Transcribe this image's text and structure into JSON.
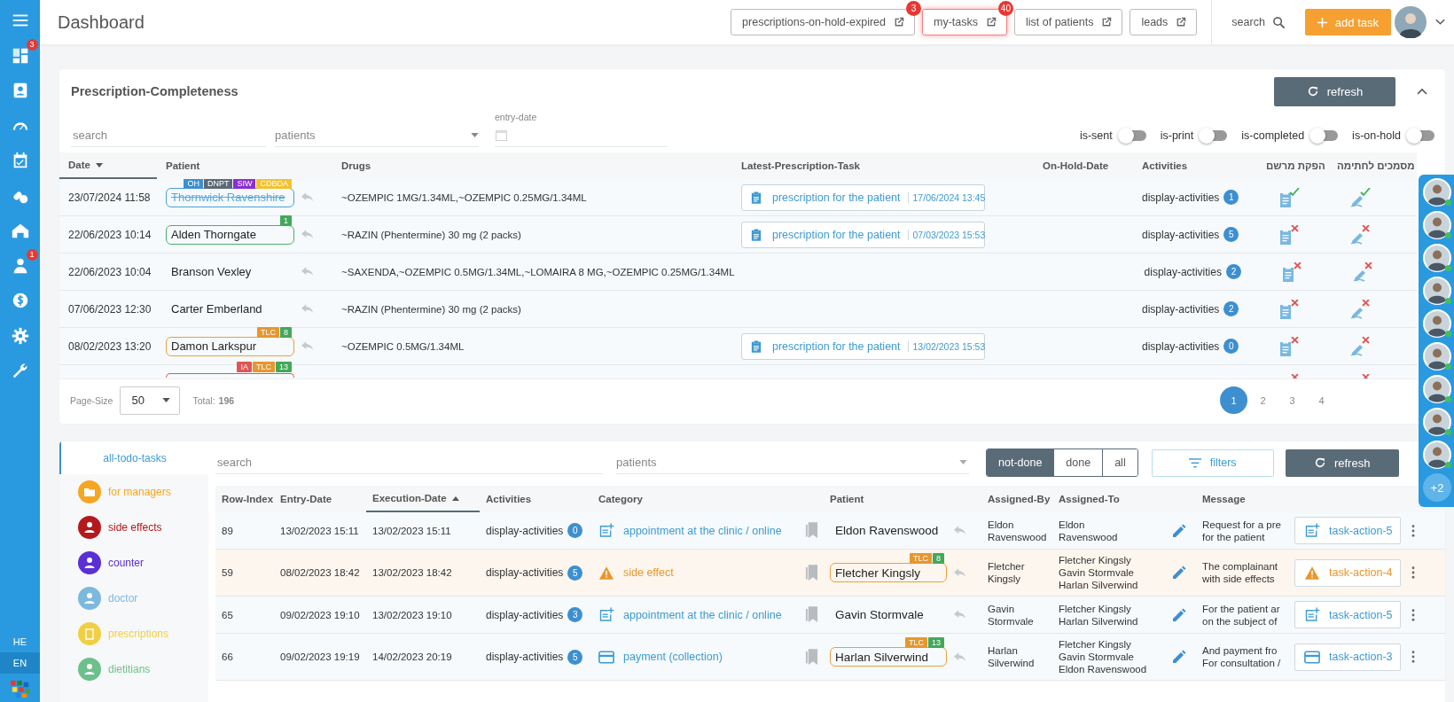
{
  "sidebar": {
    "items": [
      {
        "kind": "menu"
      },
      {
        "kind": "dashboard",
        "badge": "3"
      },
      {
        "kind": "contact"
      },
      {
        "kind": "gauge"
      },
      {
        "kind": "calendar"
      },
      {
        "kind": "pills"
      },
      {
        "kind": "home"
      },
      {
        "kind": "doctor",
        "badge": "1"
      },
      {
        "kind": "dollar"
      },
      {
        "kind": "gear"
      },
      {
        "kind": "wrench"
      }
    ],
    "languages": [
      {
        "label": "HE",
        "selected": false
      },
      {
        "label": "EN",
        "selected": true
      }
    ]
  },
  "header": {
    "title": "Dashboard",
    "links": [
      {
        "label": "prescriptions-on-hold-expired",
        "badge": "3",
        "highlighted": false
      },
      {
        "label": "my-tasks",
        "badge": "40",
        "highlighted": true
      },
      {
        "label": "list of patients",
        "highlighted": false
      },
      {
        "label": "leads",
        "highlighted": false
      }
    ],
    "search": "search",
    "add_button": "add task"
  },
  "prescriptions": {
    "title": "Prescription-Completeness",
    "refresh": "refresh",
    "expanded": true,
    "search_placeholder": "search",
    "patients_placeholder": "patients",
    "date_label": "entry-date",
    "toggles": [
      {
        "label": "is-sent",
        "on": false
      },
      {
        "label": "is-print",
        "on": false
      },
      {
        "label": "is-completed",
        "on": false
      },
      {
        "label": "is-on-hold",
        "on": false
      }
    ],
    "columns": [
      {
        "label": "Date",
        "sorted": true,
        "descending": true
      },
      {
        "label": "Patient",
        "sorted": false
      },
      {
        "label": "Drugs",
        "sorted": false
      },
      {
        "label": "Latest-Prescription-Task",
        "sorted": false
      },
      {
        "label": "On-Hold-Date",
        "sorted": false
      },
      {
        "label": "Activities",
        "sorted": false
      },
      {
        "label": "הפקת מרשם",
        "sorted": false
      },
      {
        "label": "מסמכים לחתימה",
        "sorted": false
      }
    ],
    "rows": [
      {
        "date": "23/07/2024 11:58",
        "patient": {
          "name": "Thornwick Ravenshire",
          "struck": true,
          "color": "#4a9fd6",
          "tags": [
            {
              "label": "OH",
              "color": "#3d8fd0"
            },
            {
              "label": "DNPT",
              "color": "#5d6a75"
            },
            {
              "label": "SIW",
              "color": "#8a2fd0"
            },
            {
              "label": "CDBDA",
              "color": "#f2c230"
            }
          ]
        },
        "drugs": "~OZEMPIC 1MG/1.34ML,~OZEMPIC 0.25MG/1.34ML",
        "task": {
          "label": "prescription for the patient",
          "date": "17/06/2024 13:45"
        },
        "activities": {
          "label": "display-activities",
          "count": "1"
        },
        "dispensed": true,
        "signed": true
      },
      {
        "date": "22/06/2023 10:14",
        "patient": {
          "name": "Alden Thorngate",
          "struck": false,
          "color": "#4caf6a",
          "tags": [
            {
              "label": "1",
              "color": "#43a85a"
            }
          ]
        },
        "drugs": "~RAZIN (Phentermine) 30 mg (2 packs)",
        "task": {
          "label": "prescription for the patient",
          "date": "07/03/2023 15:53"
        },
        "activities": {
          "label": "display-activities",
          "count": "5"
        },
        "dispensed": false,
        "signed": false
      },
      {
        "date": "22/06/2023 10:04",
        "patient": {
          "name": "Branson Vexley",
          "struck": false
        },
        "drugs": "~SAXENDA,~OZEMPIC 0.5MG/1.34ML,~LOMAIRA 8 MG,~OZEMPIC 0.25MG/1.34ML",
        "activities": {
          "label": "display-activities",
          "count": "2"
        },
        "dispensed": false,
        "signed": false
      },
      {
        "date": "07/06/2023 12:30",
        "patient": {
          "name": "Carter Emberland",
          "struck": false
        },
        "drugs": "~RAZIN (Phentermine) 30 mg (2 packs)",
        "activities": {
          "label": "display-activities",
          "count": "2"
        },
        "dispensed": false,
        "signed": false
      },
      {
        "date": "08/02/2023 13:20",
        "patient": {
          "name": "Damon Larkspur",
          "struck": false,
          "color": "#e8a040",
          "tags": [
            {
              "label": "TLC",
              "color": "#e8962e"
            },
            {
              "label": "8",
              "color": "#43a85a"
            }
          ]
        },
        "drugs": "~OZEMPIC 0.5MG/1.34ML",
        "task": {
          "label": "prescription for the patient",
          "date": "13/02/2023 15:53"
        },
        "activities": {
          "label": "display-activities",
          "count": "0"
        },
        "dispensed": false,
        "signed": false
      },
      {
        "patient": {
          "color": "#e05555",
          "tags": [
            {
              "label": "IA",
              "color": "#e05555"
            },
            {
              "label": "TLC",
              "color": "#e8962e"
            },
            {
              "label": "13",
              "color": "#43a85a"
            }
          ]
        },
        "dispensed": false,
        "signed": false
      }
    ],
    "page_size_label": "Page-Size",
    "page_size": "50",
    "total_label": "Total:",
    "total": "196",
    "pages": [
      {
        "label": "1",
        "selected": true
      },
      {
        "label": "2",
        "selected": false
      },
      {
        "label": "3",
        "selected": false
      },
      {
        "label": "4",
        "selected": false
      }
    ]
  },
  "tasks": {
    "tabs": [
      {
        "label": "all-todo-tasks",
        "selected": true
      }
    ],
    "categories": [
      {
        "kind": "managers",
        "label": "for managers",
        "color": "#f5a623"
      },
      {
        "kind": "side-effects",
        "label": "side effects",
        "color": "#b3191c"
      },
      {
        "kind": "counter",
        "label": "counter",
        "color": "#5a2fd6"
      },
      {
        "kind": "doctor",
        "label": "doctor",
        "color": "#7db8de"
      },
      {
        "kind": "prescriptions",
        "label": "prescriptions",
        "color": "#f0cf45"
      },
      {
        "kind": "dietitians",
        "label": "dietitians",
        "color": "#6cc08b"
      }
    ],
    "search_placeholder": "search",
    "patients_placeholder": "patients",
    "status": [
      {
        "label": "not-done",
        "selected": true
      },
      {
        "label": "done",
        "selected": false
      },
      {
        "label": "all",
        "selected": false
      }
    ],
    "filters": "filters",
    "refresh": "refresh",
    "columns": [
      {
        "label": "Row-Index",
        "sorted": false
      },
      {
        "label": "Entry-Date",
        "sorted": false
      },
      {
        "label": "Execution-Date",
        "sorted": true,
        "descending": false
      },
      {
        "label": "Activities",
        "sorted": false
      },
      {
        "label": "Category",
        "sorted": false
      },
      {
        "label": "Patient",
        "sorted": false
      },
      {
        "label": "Assigned-By",
        "sorted": false
      },
      {
        "label": "Assigned-To",
        "sorted": false
      },
      {
        "label": "Message",
        "sorted": false
      }
    ],
    "rows": [
      {
        "index": "89",
        "entry": "13/02/2023 15:11",
        "execution": "13/02/2023 15:11",
        "activities": {
          "label": "display-activities",
          "count": "0"
        },
        "highlighted": false,
        "category": {
          "kind": "appointment",
          "label": "appointment at the clinic / online",
          "color": "#3d9bd2"
        },
        "patient": {
          "name": "Eldon Ravenswood"
        },
        "assigned_by": [
          "Eldon",
          "Ravenswood"
        ],
        "assigned_to": [
          "Eldon",
          "Ravenswood"
        ],
        "message": [
          "Request for a pre",
          "for the patient"
        ],
        "action": {
          "kind": "appointment",
          "label": "task-action-5",
          "color": "#3d9bd2"
        }
      },
      {
        "index": "59",
        "entry": "08/02/2023 18:42",
        "execution": "13/02/2023 18:42",
        "activities": {
          "label": "display-activities",
          "count": "5"
        },
        "highlighted": true,
        "category": {
          "kind": "warning",
          "label": "side effect",
          "color": "#e8962e"
        },
        "patient": {
          "name": "Fletcher Kingsly",
          "color": "#e8a040",
          "tags": [
            {
              "label": "TLC",
              "color": "#e8962e"
            },
            {
              "label": "8",
              "color": "#43a85a"
            }
          ]
        },
        "assigned_by": [
          "Fletcher",
          "Kingsly"
        ],
        "assigned_to": [
          "Fletcher Kingsly",
          "Gavin Stormvale",
          "Harlan Silverwind"
        ],
        "message": [
          "The complainant",
          "with side effects"
        ],
        "action": {
          "kind": "warning",
          "label": "task-action-4",
          "color": "#e8962e"
        }
      },
      {
        "index": "65",
        "entry": "09/02/2023 19:10",
        "execution": "13/02/2023 19:10",
        "activities": {
          "label": "display-activities",
          "count": "3"
        },
        "highlighted": false,
        "category": {
          "kind": "appointment",
          "label": "appointment at the clinic / online",
          "color": "#3d9bd2"
        },
        "patient": {
          "name": "Gavin Stormvale"
        },
        "assigned_by": [
          "Gavin",
          "Stormvale"
        ],
        "assigned_to": [
          "Fletcher Kingsly",
          "Harlan Silverwind"
        ],
        "message": [
          "For the patient ar",
          "on the subject of"
        ],
        "action": {
          "kind": "appointment",
          "label": "task-action-5",
          "color": "#3d9bd2"
        }
      },
      {
        "index": "66",
        "entry": "09/02/2023 19:19",
        "execution": "14/02/2023 20:19",
        "activities": {
          "label": "display-activities",
          "count": "5"
        },
        "highlighted": false,
        "category": {
          "kind": "payment",
          "label": "payment (collection)",
          "color": "#3d9bd2"
        },
        "patient": {
          "name": "Harlan Silverwind",
          "color": "#e8a040",
          "tags": [
            {
              "label": "TLC",
              "color": "#e8962e"
            },
            {
              "label": "13",
              "color": "#43a85a"
            }
          ]
        },
        "assigned_by": [
          "Harlan",
          "Silverwind"
        ],
        "assigned_to": [
          "Fletcher Kingsly",
          "Gavin Stormvale",
          "Eldon Ravenswood"
        ],
        "message": [
          "And payment fro",
          "For consultation /"
        ],
        "action": {
          "kind": "payment",
          "label": "task-action-3",
          "color": "#3d9bd2"
        }
      }
    ]
  },
  "online_users": {
    "avatars": [
      {
        "online": true
      },
      {
        "online": true
      },
      {
        "online": true
      },
      {
        "online": true
      },
      {
        "online": true
      },
      {
        "online": true
      },
      {
        "online": true
      },
      {
        "online": true
      },
      {
        "online": true
      }
    ],
    "more": "+2"
  }
}
